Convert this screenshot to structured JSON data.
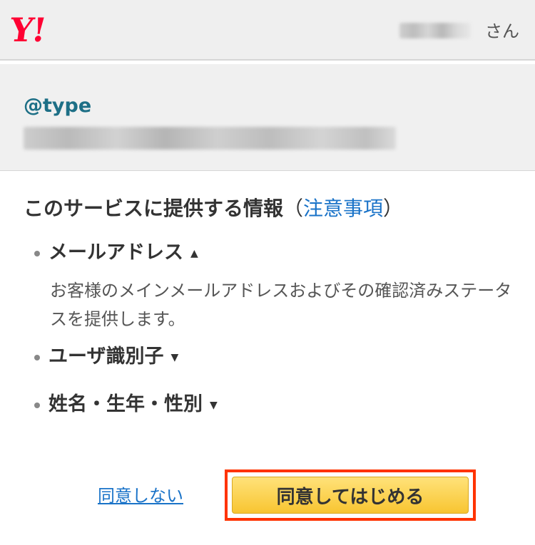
{
  "header": {
    "logo_text": "Y!",
    "user_suffix": "さん"
  },
  "app": {
    "name": "@type"
  },
  "section": {
    "title": "このサービスに提供する情報",
    "paren_open": "（",
    "notes_link": "注意事項",
    "paren_close": "）"
  },
  "items": [
    {
      "label": "メールアドレス",
      "caret": "▲",
      "expanded": true,
      "description": "お客様のメインメールアドレスおよびその確認済みステータスを提供します。"
    },
    {
      "label": "ユーザ識別子",
      "caret": "▼",
      "expanded": false
    },
    {
      "label": "姓名・生年・性別",
      "caret": "▼",
      "expanded": false
    }
  ],
  "actions": {
    "decline_label": "同意しない",
    "agree_label": "同意してはじめる"
  },
  "colors": {
    "brand": "#ff0033",
    "link": "#1a73c8",
    "app_name": "#1d6f86",
    "agree_button": "#f8c531",
    "highlight_outline": "#ff3300"
  }
}
